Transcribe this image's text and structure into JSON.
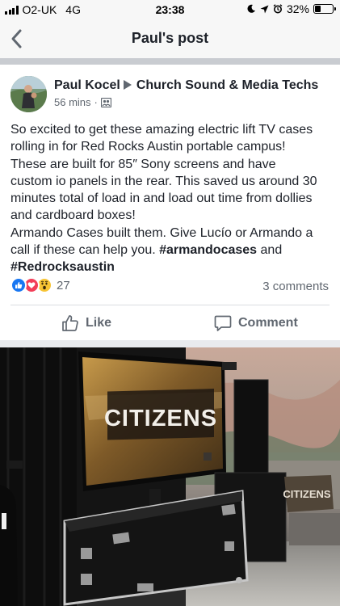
{
  "status_bar": {
    "carrier": "O2-UK",
    "network": "4G",
    "time": "23:38",
    "battery_percent": "32%",
    "battery_level": 0.32
  },
  "nav": {
    "title": "Paul's post"
  },
  "post": {
    "author": "Paul Kocel",
    "group": "Church Sound & Media Techs",
    "time_ago": "56 mins",
    "privacy_icon": "group-icon",
    "body_lines": [
      "So excited to get these amazing electric lift TV cases",
      "rolling in for Red Rocks Austin portable campus!",
      "These are built for  85″ Sony screens and have",
      "custom io panels in the rear. This saved us around 30",
      "minutes total of load in and load out time from dollies",
      "and cardboard boxes!",
      "Armando Cases built them. Give Lucío or Armando a"
    ],
    "body_line_8_prefix": "call if these can help you. ",
    "hashtag_1": "#armandocases",
    "body_line_8_suffix": " and",
    "hashtag_2": "#Redrocksaustin",
    "reaction_count": "27",
    "comments_count": "3 comments",
    "like_label": "Like",
    "comment_label": "Comment",
    "photo": {
      "screen_text": "CITIZENS",
      "monitor_text": "CITIZENS"
    }
  },
  "colors": {
    "like_blue": "#1877f2",
    "love_red": "#f33e58",
    "wow_yellow": "#f7c434",
    "secondary_text": "#606770"
  }
}
